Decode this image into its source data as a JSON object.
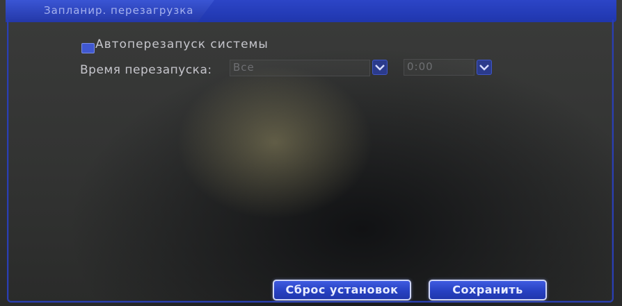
{
  "window": {
    "title": "Запланир. перезагрузка"
  },
  "auto_restart": {
    "label": "Автоперезапуск системы",
    "checked": true
  },
  "restart_time": {
    "label": "Время перезапуска:",
    "day_value": "Все",
    "time_value": "0:00"
  },
  "buttons": {
    "reset_label": "Сброс установок",
    "save_label": "Сохранить"
  },
  "colors": {
    "accent": "#2c45c7",
    "text": "#c6c6cc",
    "disabled_text": "#6e6f72"
  },
  "icons": {
    "dropdown": "chevron-down-icon"
  }
}
